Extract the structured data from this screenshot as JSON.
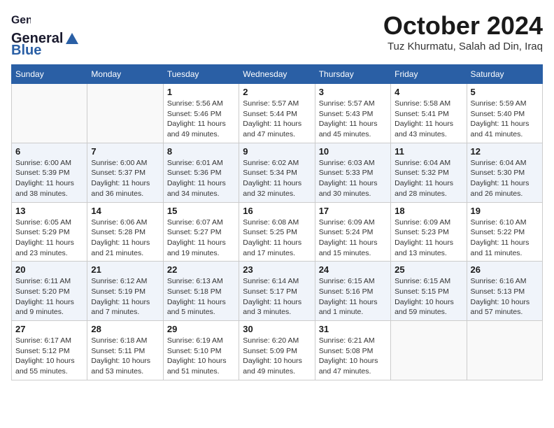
{
  "header": {
    "logo_general": "General",
    "logo_blue": "Blue",
    "month_title": "October 2024",
    "location": "Tuz Khurmatu, Salah ad Din, Iraq"
  },
  "days_of_week": [
    "Sunday",
    "Monday",
    "Tuesday",
    "Wednesday",
    "Thursday",
    "Friday",
    "Saturday"
  ],
  "weeks": [
    [
      {
        "day": "",
        "empty": true
      },
      {
        "day": "",
        "empty": true
      },
      {
        "day": "1",
        "sunrise": "5:56 AM",
        "sunset": "5:46 PM",
        "daylight": "11 hours and 49 minutes."
      },
      {
        "day": "2",
        "sunrise": "5:57 AM",
        "sunset": "5:44 PM",
        "daylight": "11 hours and 47 minutes."
      },
      {
        "day": "3",
        "sunrise": "5:57 AM",
        "sunset": "5:43 PM",
        "daylight": "11 hours and 45 minutes."
      },
      {
        "day": "4",
        "sunrise": "5:58 AM",
        "sunset": "5:41 PM",
        "daylight": "11 hours and 43 minutes."
      },
      {
        "day": "5",
        "sunrise": "5:59 AM",
        "sunset": "5:40 PM",
        "daylight": "11 hours and 41 minutes."
      }
    ],
    [
      {
        "day": "6",
        "sunrise": "6:00 AM",
        "sunset": "5:39 PM",
        "daylight": "11 hours and 38 minutes."
      },
      {
        "day": "7",
        "sunrise": "6:00 AM",
        "sunset": "5:37 PM",
        "daylight": "11 hours and 36 minutes."
      },
      {
        "day": "8",
        "sunrise": "6:01 AM",
        "sunset": "5:36 PM",
        "daylight": "11 hours and 34 minutes."
      },
      {
        "day": "9",
        "sunrise": "6:02 AM",
        "sunset": "5:34 PM",
        "daylight": "11 hours and 32 minutes."
      },
      {
        "day": "10",
        "sunrise": "6:03 AM",
        "sunset": "5:33 PM",
        "daylight": "11 hours and 30 minutes."
      },
      {
        "day": "11",
        "sunrise": "6:04 AM",
        "sunset": "5:32 PM",
        "daylight": "11 hours and 28 minutes."
      },
      {
        "day": "12",
        "sunrise": "6:04 AM",
        "sunset": "5:30 PM",
        "daylight": "11 hours and 26 minutes."
      }
    ],
    [
      {
        "day": "13",
        "sunrise": "6:05 AM",
        "sunset": "5:29 PM",
        "daylight": "11 hours and 23 minutes."
      },
      {
        "day": "14",
        "sunrise": "6:06 AM",
        "sunset": "5:28 PM",
        "daylight": "11 hours and 21 minutes."
      },
      {
        "day": "15",
        "sunrise": "6:07 AM",
        "sunset": "5:27 PM",
        "daylight": "11 hours and 19 minutes."
      },
      {
        "day": "16",
        "sunrise": "6:08 AM",
        "sunset": "5:25 PM",
        "daylight": "11 hours and 17 minutes."
      },
      {
        "day": "17",
        "sunrise": "6:09 AM",
        "sunset": "5:24 PM",
        "daylight": "11 hours and 15 minutes."
      },
      {
        "day": "18",
        "sunrise": "6:09 AM",
        "sunset": "5:23 PM",
        "daylight": "11 hours and 13 minutes."
      },
      {
        "day": "19",
        "sunrise": "6:10 AM",
        "sunset": "5:22 PM",
        "daylight": "11 hours and 11 minutes."
      }
    ],
    [
      {
        "day": "20",
        "sunrise": "6:11 AM",
        "sunset": "5:20 PM",
        "daylight": "11 hours and 9 minutes."
      },
      {
        "day": "21",
        "sunrise": "6:12 AM",
        "sunset": "5:19 PM",
        "daylight": "11 hours and 7 minutes."
      },
      {
        "day": "22",
        "sunrise": "6:13 AM",
        "sunset": "5:18 PM",
        "daylight": "11 hours and 5 minutes."
      },
      {
        "day": "23",
        "sunrise": "6:14 AM",
        "sunset": "5:17 PM",
        "daylight": "11 hours and 3 minutes."
      },
      {
        "day": "24",
        "sunrise": "6:15 AM",
        "sunset": "5:16 PM",
        "daylight": "11 hours and 1 minute."
      },
      {
        "day": "25",
        "sunrise": "6:15 AM",
        "sunset": "5:15 PM",
        "daylight": "10 hours and 59 minutes."
      },
      {
        "day": "26",
        "sunrise": "6:16 AM",
        "sunset": "5:13 PM",
        "daylight": "10 hours and 57 minutes."
      }
    ],
    [
      {
        "day": "27",
        "sunrise": "6:17 AM",
        "sunset": "5:12 PM",
        "daylight": "10 hours and 55 minutes."
      },
      {
        "day": "28",
        "sunrise": "6:18 AM",
        "sunset": "5:11 PM",
        "daylight": "10 hours and 53 minutes."
      },
      {
        "day": "29",
        "sunrise": "6:19 AM",
        "sunset": "5:10 PM",
        "daylight": "10 hours and 51 minutes."
      },
      {
        "day": "30",
        "sunrise": "6:20 AM",
        "sunset": "5:09 PM",
        "daylight": "10 hours and 49 minutes."
      },
      {
        "day": "31",
        "sunrise": "6:21 AM",
        "sunset": "5:08 PM",
        "daylight": "10 hours and 47 minutes."
      },
      {
        "day": "",
        "empty": true
      },
      {
        "day": "",
        "empty": true
      }
    ]
  ]
}
